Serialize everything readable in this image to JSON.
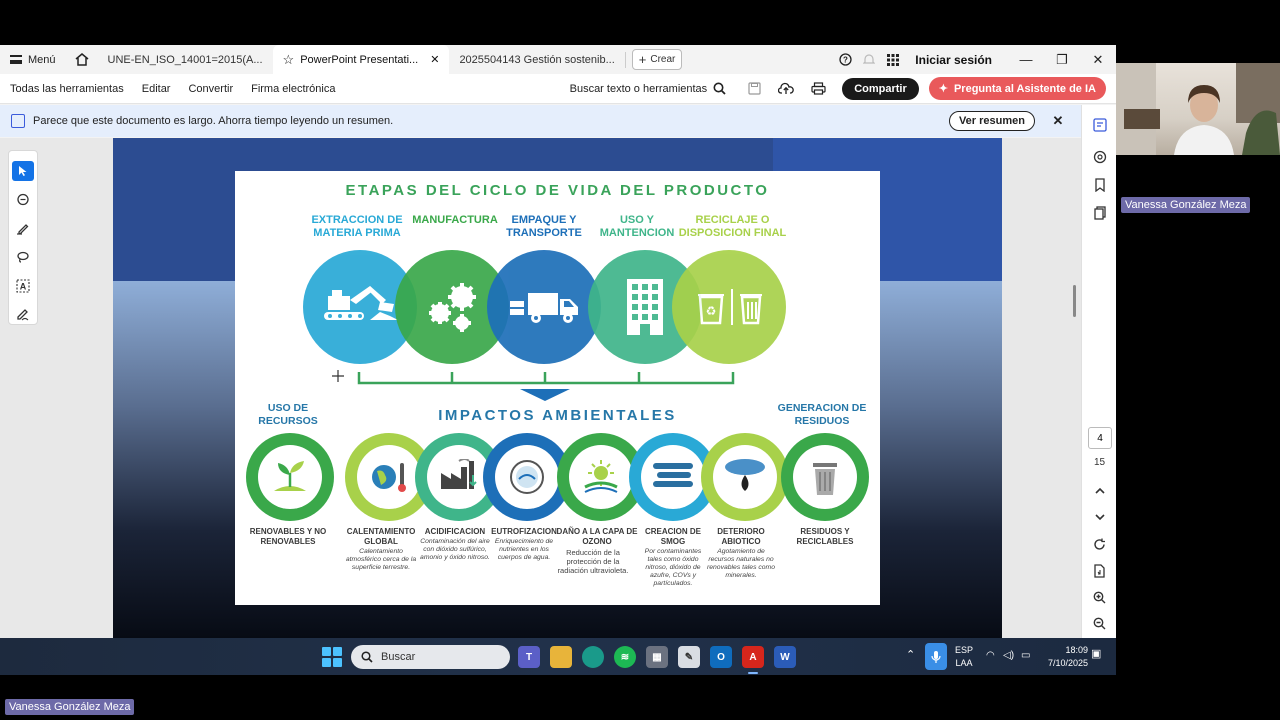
{
  "tabs": {
    "menu_label": "Menú",
    "items": [
      {
        "label": "UNE-EN_ISO_14001=2015(A...",
        "active": false
      },
      {
        "label": "PowerPoint Presentati...",
        "active": true
      },
      {
        "label": "2025504143 Gestión sostenib...",
        "active": false
      }
    ],
    "new_tab_label": "Crear",
    "signin_label": "Iniciar sesión"
  },
  "toolbar": {
    "items": [
      "Todas las herramientas",
      "Editar",
      "Convertir",
      "Firma electrónica"
    ],
    "search_label": "Buscar texto o herramientas",
    "share_label": "Compartir",
    "ai_label": "Pregunta al Asistente de IA"
  },
  "notice": {
    "text": "Parece que este documento es largo. Ahorra tiempo leyendo un resumen.",
    "button_label": "Ver resumen"
  },
  "slide": {
    "title": "ETAPAS DEL CICLO DE VIDA DEL PRODUCTO",
    "stages": [
      {
        "label": "EXTRACCION DE MATERIA PRIMA",
        "color": "#29a9d6"
      },
      {
        "label": "MANUFACTURA",
        "color": "#3aa84a"
      },
      {
        "label": "EMPAQUE Y TRANSPORTE",
        "color": "#1d6fb8"
      },
      {
        "label": "USO Y MANTENCION",
        "color": "#3fb58a"
      },
      {
        "label": "RECICLAJE O DISPOSICION FINAL",
        "color": "#a8d14a"
      }
    ],
    "impacts_title": "IMPACTOS AMBIENTALES",
    "left_group": "USO DE RECURSOS",
    "right_group": "GENERACION DE RESIDUOS",
    "impacts": [
      {
        "label": "RENOVABLES Y NO RENOVABLES",
        "desc": ""
      },
      {
        "label": "CALENTAMIENTO GLOBAL",
        "desc": "Calentamiento atmosférico cerca de la superficie terrestre."
      },
      {
        "label": "ACIDIFICACION",
        "desc": "Contaminación del aire con dióxido sulfúrico, amonio y óxido nitroso."
      },
      {
        "label": "EUTROFIZACION",
        "desc": "Enriquecimiento de nutrientes en los cuerpos de agua."
      },
      {
        "label": "DAÑO A LA CAPA DE OZONO",
        "desc": "Reducción de la protección de la radiación ultravioleta."
      },
      {
        "label": "CREACION DE SMOG",
        "desc": "Por contaminantes tales como óxido nitroso, dióxido de azufre, COVs y partículados."
      },
      {
        "label": "DETERIORO ABIOTICO",
        "desc": "Agotamiento de recursos naturales no renovables tales como minerales."
      },
      {
        "label": "RESIDUOS Y RECICLABLES",
        "desc": ""
      }
    ]
  },
  "pager": {
    "current": "4",
    "total": "15"
  },
  "taskbar": {
    "search_label": "Buscar",
    "lang_top": "ESP",
    "lang_bottom": "LAA",
    "time": "18:09",
    "date": "7/10/2025"
  },
  "participant": {
    "name_top": "Vanessa González Meza",
    "name_bottom": "Vanessa González Meza"
  }
}
